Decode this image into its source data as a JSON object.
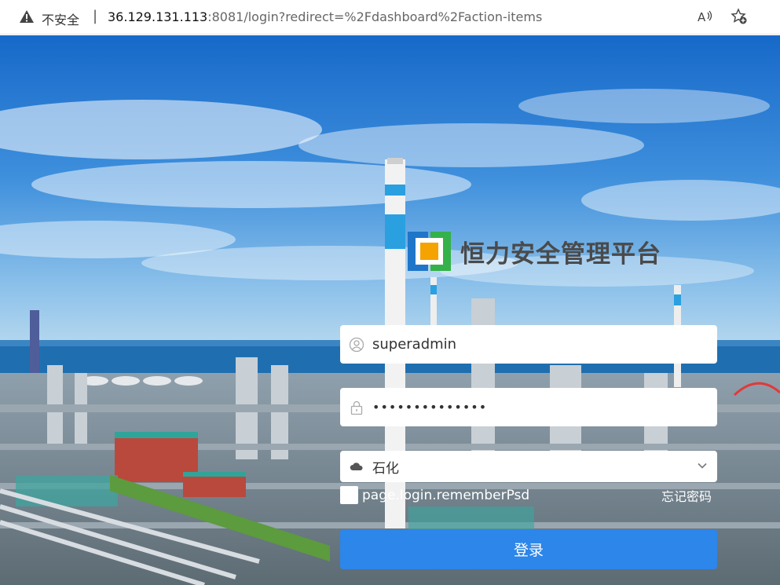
{
  "browser": {
    "insecure_label": "不安全",
    "separator": "|",
    "url_host": "36.129.131.113",
    "url_rest": ":8081/login?redirect=%2Fdashboard%2Faction-items",
    "icons": [
      "warning-icon",
      "read-aloud-icon",
      "favorites-add-icon"
    ]
  },
  "brand": {
    "title": "恒力安全管理平台",
    "colors": {
      "blue": "#1f76c9",
      "green": "#35b14a",
      "orange": "#f5a300"
    }
  },
  "form": {
    "username_value": "superadmin",
    "password_value": "••••••••••••••",
    "tenant_value": "石化",
    "remember_label": "page.login.rememberPsd",
    "forgot_label": "忘记密码",
    "submit_label": "登录"
  },
  "colors": {
    "accent": "#2d86e9"
  }
}
